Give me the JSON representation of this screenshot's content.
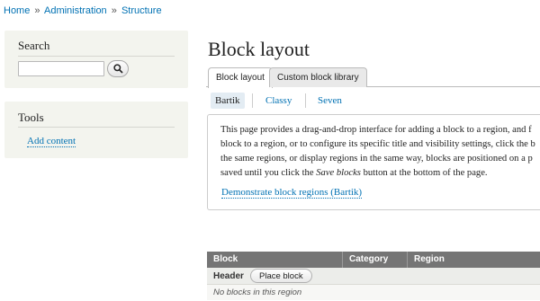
{
  "breadcrumb": {
    "items": [
      "Home",
      "Administration",
      "Structure"
    ],
    "separator": "»"
  },
  "sidebar": {
    "search": {
      "title": "Search",
      "input_value": "",
      "button_icon": "search-icon"
    },
    "tools": {
      "title": "Tools",
      "links": [
        "Add content"
      ]
    }
  },
  "main": {
    "title": "Block layout",
    "tabs": [
      {
        "label": "Block layout",
        "active": true
      },
      {
        "label": "Custom block library",
        "active": false
      }
    ],
    "subtabs": [
      {
        "label": "Bartik",
        "active": true
      },
      {
        "label": "Classy",
        "active": false
      },
      {
        "label": "Seven",
        "active": false
      }
    ],
    "help": {
      "lines": [
        "This page provides a drag-and-drop interface for adding a block to a region, and f",
        "block to a region, or to configure its specific title and visibility settings, click the b",
        "the same regions, or display regions in the same way, blocks are positioned on a p"
      ],
      "last_line_prefix": "saved until you click the ",
      "last_line_emphasis": "Save blocks",
      "last_line_suffix": " button at the bottom of the page.",
      "link": "Demonstrate block regions (Bartik)"
    },
    "table": {
      "headers": [
        "Block",
        "Category",
        "Region"
      ],
      "region_title": "Header",
      "place_block_label": "Place block",
      "empty_message": "No blocks in this region"
    }
  },
  "colors": {
    "link": "#0071b3",
    "sidebar_bg": "#f3f4ee",
    "table_header_bg": "#757575"
  }
}
